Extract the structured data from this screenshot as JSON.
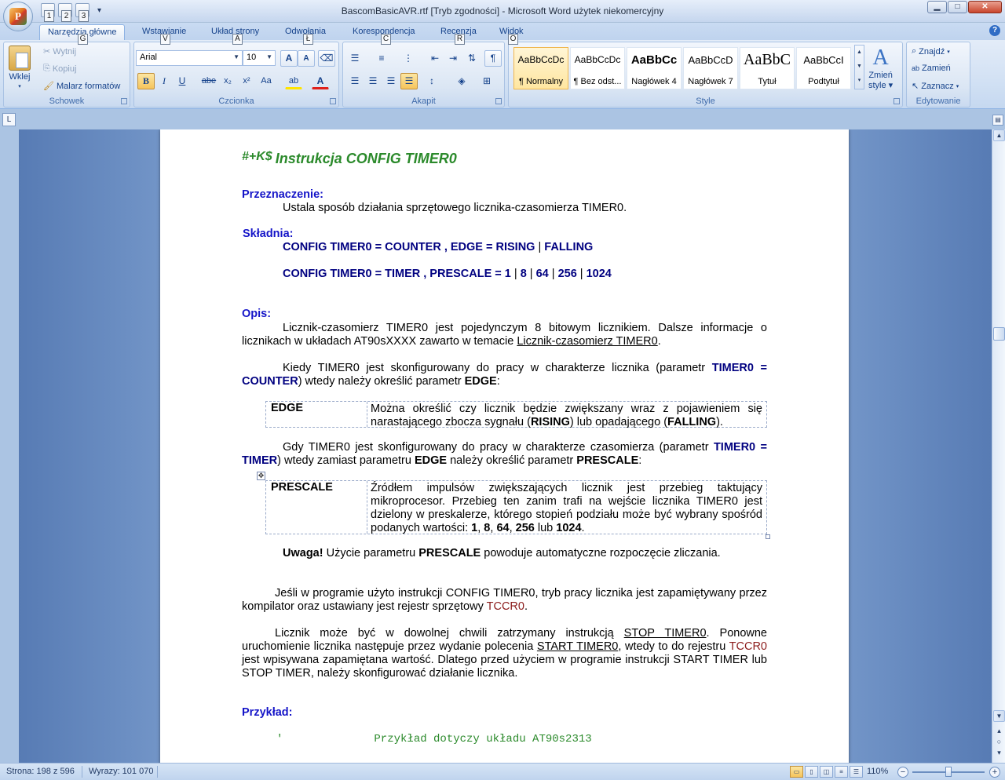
{
  "window": {
    "title": "BascomBasicAVR.rtf [Tryb zgodności] - Microsoft Word użytek niekomercyjny",
    "office_logo": "P",
    "qat_keytips": [
      "1",
      "2",
      "3"
    ],
    "minimize": "▁",
    "maximize": "□",
    "close": "✕"
  },
  "tabs": [
    {
      "label": "Narzędzia główne",
      "keytip": "G",
      "active": true
    },
    {
      "label": "Wstawianie",
      "keytip": "V"
    },
    {
      "label": "Układ strony",
      "keytip": "A"
    },
    {
      "label": "Odwołania",
      "keytip": "Ł"
    },
    {
      "label": "Korespondencja",
      "keytip": "C"
    },
    {
      "label": "Recenzja",
      "keytip": "R"
    },
    {
      "label": "Widok",
      "keytip": "O"
    }
  ],
  "ribbon": {
    "clipboard": {
      "label": "Schowek",
      "paste": "Wklej",
      "cut": "Wytnij",
      "copy": "Kopiuj",
      "format_painter": "Malarz formatów"
    },
    "font": {
      "label": "Czcionka",
      "font_name": "Arial",
      "font_size": "10",
      "grow": "A",
      "shrink": "A",
      "bold": "B",
      "italic": "I",
      "underline": "U",
      "strike": "abe",
      "subscript": "x₂",
      "superscript": "x²",
      "change_case": "Aa",
      "highlight": "ab",
      "font_color": "A"
    },
    "paragraph": {
      "label": "Akapit"
    },
    "styles": {
      "label": "Style",
      "items": [
        {
          "sample": "AaBbCcDc",
          "name": "¶ Normalny"
        },
        {
          "sample": "AaBbCcDc",
          "name": "¶ Bez odst..."
        },
        {
          "sample": "AaBbCc",
          "name": "Nagłówek 4"
        },
        {
          "sample": "AaBbCcD",
          "name": "Nagłówek 7"
        },
        {
          "sample": "AaBbC",
          "name": "Tytuł"
        },
        {
          "sample": "AaBbCcI",
          "name": "Podtytuł"
        }
      ],
      "change_styles": "Zmień",
      "change_styles_2": "style"
    },
    "editing": {
      "label": "Edytowanie",
      "find": "Znajdź",
      "replace": "Zamień",
      "select": "Zaznacz"
    }
  },
  "document": {
    "title_prefix": "#+K$",
    "title": "Instrukcja CONFIG TIMER0",
    "purpose_header": "Przeznaczenie:",
    "purpose_text": "Ustala sposób działania  sprzętowego licznika-czasomierza TIMER0.",
    "syntax_header": "Składnia:",
    "syntax1_a": "CONFIG TIMER0 = COUNTER , EDGE = RISING",
    "syntax1_sep": " | ",
    "syntax1_b": "FALLING",
    "syntax2_a": "CONFIG TIMER0 = TIMER , PRESCALE = 1",
    "syntax2_opts": [
      "8",
      "64",
      "256",
      "1024"
    ],
    "desc_header": "Opis:",
    "desc1": "Licznik-czasomierz TIMER0 jest pojedynczym 8 bitowym licznikiem. Dalsze informacje o licznikach w układach AT90sXXXX zawarto w temacie ",
    "desc1_link": "Licznik-czasomierz TIMER0",
    "desc2_a": "Kiedy TIMER0 jest skonfigurowany do pracy w charakterze licznika (parametr ",
    "desc2_b": "TIMER0 = COUNTER",
    "desc2_c": ") wtedy należy określić parametr ",
    "desc2_d": "EDGE",
    "edge_param": "EDGE",
    "edge_text_a": "Można określić czy licznik będzie zwiększany wraz z pojawieniem się narastającego zbocza sygnału (",
    "edge_rising": "RISING",
    "edge_text_b": ") lub opadającego (",
    "edge_falling": "FALLING",
    "desc3_a": "Gdy TIMER0 jest skonfigurowany do pracy w charakterze czasomierza (parametr ",
    "desc3_b": "TIMER0 = TIMER",
    "desc3_c": ") wtedy zamiast parametru ",
    "desc3_d": "EDGE",
    "desc3_e": " należy określić parametr ",
    "desc3_f": "PRESCALE",
    "prescale_param": "PRESCALE",
    "prescale_text": "Źródłem impulsów zwiększających licznik jest przebieg taktujący mikroprocesor. Przebieg ten zanim trafi na wejście licznika TIMER0 jest dzielony w preskalerze, którego stopień podziału może być wybrany spośród podanych wartości: ",
    "prescale_values": [
      "1",
      "8",
      "64",
      "256"
    ],
    "prescale_or": " lub ",
    "prescale_last": "1024",
    "note_label": "Uwaga!",
    "note_a": " Użycie parametru ",
    "note_b": "PRESCALE",
    "note_c": " powoduje automatyczne rozpoczęcie zliczania.",
    "para4_a": "Jeśli w programie użyto instrukcji CONFIG TIMER0, tryb pracy licznika jest zapamiętywany przez kompilator oraz ustawiany jest rejestr sprzętowy ",
    "para4_reg": "TCCR0",
    "para5_a": "Licznik może być w dowolnej chwili zatrzymany instrukcją ",
    "para5_link1": "STOP TIMER0",
    "para5_b": ". Ponowne uruchomienie licznika następuje przez wydanie polecenia ",
    "para5_link2": "START TIMER0",
    "para5_c": ", wtedy to do rejestru ",
    "para5_reg": "TCCR0",
    "para5_d": " jest wpisywana zapamiętana wartość. Dlatego przed użyciem w programie instrukcji START TIMER lub STOP TIMER, należy skonfigurować działanie licznika.",
    "example_header": "Przykład:",
    "code_line1_quote": "'",
    "code_line1": "Przykład dotyczy układu AT90s2313"
  },
  "status": {
    "page": "Strona: 198 z 596",
    "words": "Wyrazy: 101 070",
    "zoom": "110%",
    "zoom_out": "−",
    "zoom_in": "+"
  },
  "colors": {
    "title_green": "#2b8a2b",
    "header_blue": "#1515c8",
    "syntax_navy": "#000080",
    "register_maroon": "#8b1a1a"
  }
}
